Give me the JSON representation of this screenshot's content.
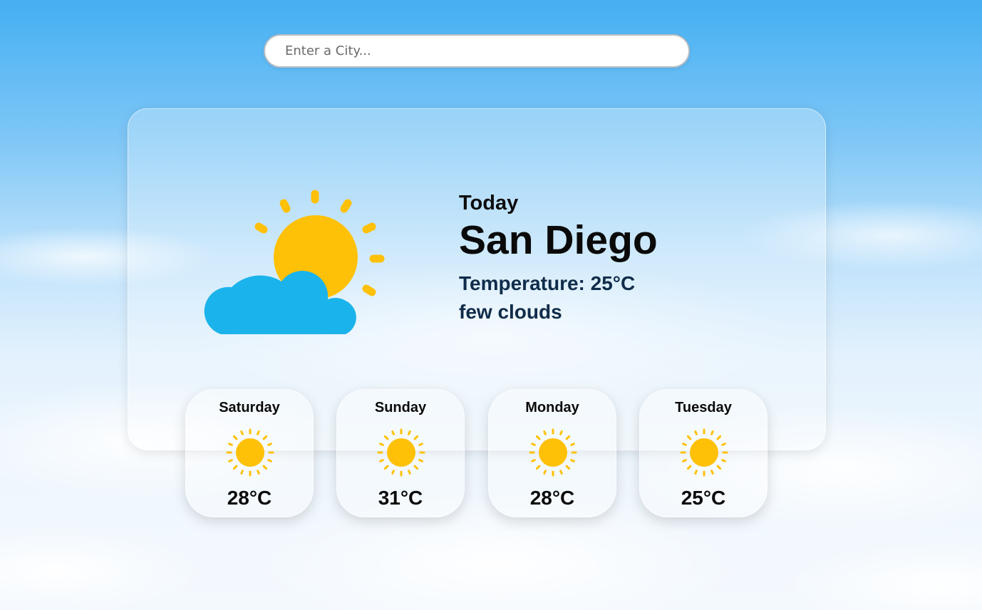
{
  "search": {
    "placeholder": "Enter a City...",
    "value": ""
  },
  "current": {
    "label": "Today",
    "city": "San Diego",
    "temperature": "Temperature: 25°C",
    "description": "few clouds",
    "icon": "sun-behind-cloud-icon"
  },
  "forecast": [
    {
      "day": "Saturday",
      "temp": "28°C",
      "icon": "sun-icon"
    },
    {
      "day": "Sunday",
      "temp": "31°C",
      "icon": "sun-icon"
    },
    {
      "day": "Monday",
      "temp": "28°C",
      "icon": "sun-icon"
    },
    {
      "day": "Tuesday",
      "temp": "25°C",
      "icon": "sun-icon"
    }
  ],
  "colors": {
    "sun": "#FFC107",
    "cloud": "#1BB3EB",
    "text_dark": "#0A0A0A",
    "text_navy": "#0F2C4A"
  }
}
